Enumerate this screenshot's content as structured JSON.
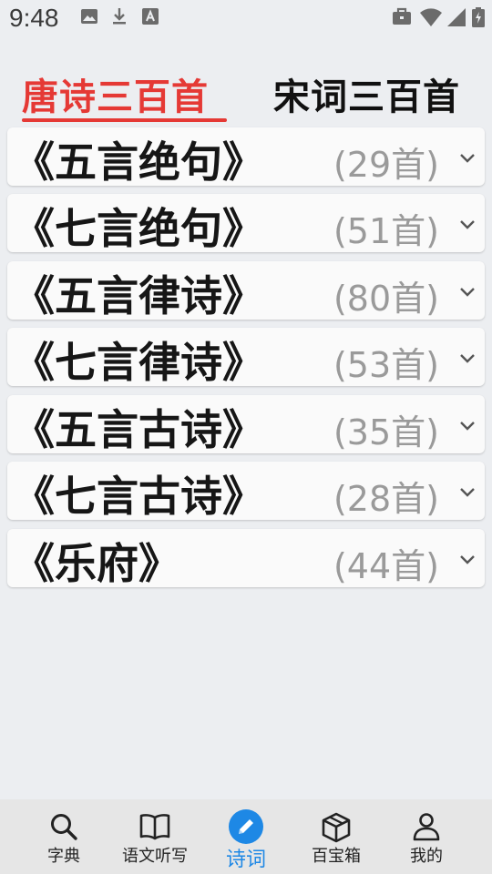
{
  "status_bar": {
    "time": "9:48"
  },
  "tabs": [
    {
      "label": "唐诗三百首",
      "active": true
    },
    {
      "label": "宋词三百首",
      "active": false
    }
  ],
  "categories": [
    {
      "title": "《五言绝句》",
      "count": "(29首)"
    },
    {
      "title": "《七言绝句》",
      "count": "(51首)"
    },
    {
      "title": "《五言律诗》",
      "count": "(80首)"
    },
    {
      "title": "《七言律诗》",
      "count": "(53首)"
    },
    {
      "title": "《五言古诗》",
      "count": "(35首)"
    },
    {
      "title": "《七言古诗》",
      "count": "(28首)"
    },
    {
      "title": "《乐府》",
      "count": "(44首)"
    }
  ],
  "bottom_nav": [
    {
      "label": "字典",
      "icon": "search-icon",
      "active": false
    },
    {
      "label": "语文听写",
      "icon": "book-icon",
      "active": false
    },
    {
      "label": "诗词",
      "icon": "pencil-icon",
      "active": true
    },
    {
      "label": "百宝箱",
      "icon": "box-icon",
      "active": false
    },
    {
      "label": "我的",
      "icon": "person-icon",
      "active": false
    }
  ],
  "colors": {
    "accent_red": "#e53935",
    "accent_blue": "#1e88e5",
    "background": "#eceef1"
  }
}
